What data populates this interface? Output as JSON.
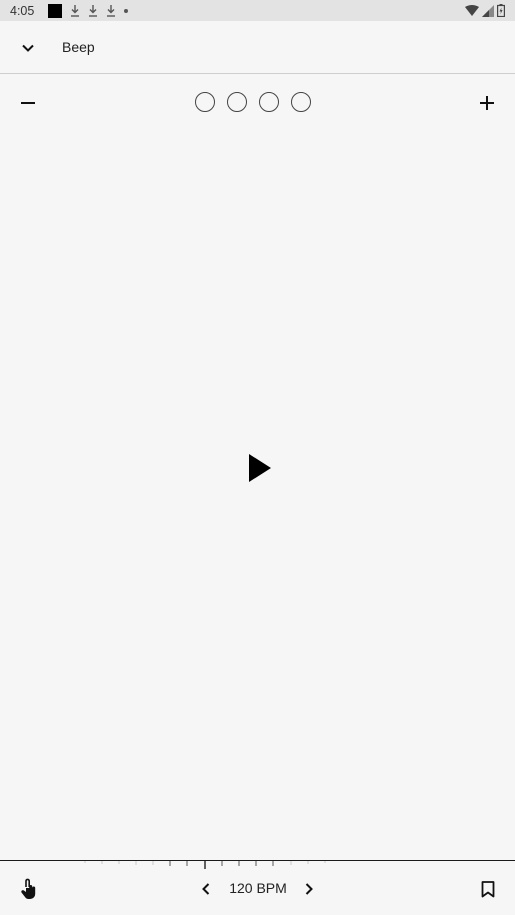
{
  "status_bar": {
    "time": "4:05",
    "icons": [
      "stop-square-icon",
      "download-icon",
      "download-icon",
      "download-icon",
      "dot-icon",
      "wifi-icon",
      "signal-icon",
      "battery-icon"
    ]
  },
  "header": {
    "collapse_icon": "chevron-down-icon",
    "sound_name": "Beep"
  },
  "beats": {
    "decrease_icon": "minus-icon",
    "increase_icon": "plus-icon",
    "count": 4
  },
  "player": {
    "play_icon": "play-icon"
  },
  "bottom_bar": {
    "tap_icon": "touch-icon",
    "prev_icon": "chevron-left-icon",
    "tempo_label": "120 BPM",
    "next_icon": "chevron-right-icon",
    "bookmark_icon": "bookmark-icon"
  },
  "colors": {
    "background": "#f6f6f6",
    "status_bar": "#e3e3e3",
    "foreground": "#000000"
  }
}
